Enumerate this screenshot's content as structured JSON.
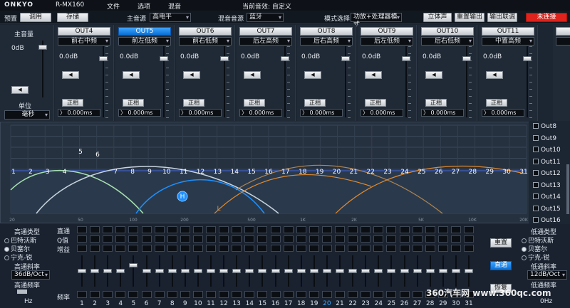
{
  "titlebar": {
    "logo": "ONKYO",
    "model": "R-MX160",
    "menus": [
      "文件",
      "选项",
      "混音"
    ],
    "preset_label": "当前音效: 自定义"
  },
  "toolbar": {
    "preset_btn": "预置",
    "call_btn": "调用",
    "save_btn": "存储",
    "main_source_label": "主音源",
    "main_source_value": "高电平",
    "mix_source_label": "混音音源",
    "mix_source_value": "蓝牙",
    "mode_label": "模式选择",
    "mode_value": "功放+处理器模式",
    "stereo_btn": "立体声",
    "reset_output_btn": "重置输出",
    "output_link_btn": "输出联调",
    "status": "未连接"
  },
  "master": {
    "title": "主音量",
    "db": "0dB",
    "unit_label": "单位",
    "unit_value": "毫秒",
    "mute_icon": "◀"
  },
  "strips": [
    {
      "out": "OUT4",
      "pos": "前右中频",
      "db": "0.0dB",
      "phase": "正相",
      "delay": "0.000ms",
      "active": false,
      "fader": 0.85
    },
    {
      "out": "OUT5",
      "pos": "前左低频",
      "db": "0.0dB",
      "phase": "正相",
      "delay": "0.000ms",
      "active": true,
      "fader": 0.85
    },
    {
      "out": "OUT6",
      "pos": "前右低频",
      "db": "0.0dB",
      "phase": "正相",
      "delay": "0.000ms",
      "active": false,
      "fader": 0.85
    },
    {
      "out": "OUT7",
      "pos": "后左高频",
      "db": "0.0dB",
      "phase": "正相",
      "delay": "0.000ms",
      "active": false,
      "fader": 0.85
    },
    {
      "out": "OUT8",
      "pos": "后右高频",
      "db": "0.0dB",
      "phase": "正相",
      "delay": "0.000ms",
      "active": false,
      "fader": 0.85
    },
    {
      "out": "OUT9",
      "pos": "后左低频",
      "db": "0.0dB",
      "phase": "正相",
      "delay": "0.000ms",
      "active": false,
      "fader": 0.85
    },
    {
      "out": "OUT10",
      "pos": "后右低频",
      "db": "0.0dB",
      "phase": "正相",
      "delay": "0.000ms",
      "active": false,
      "fader": 0.85
    },
    {
      "out": "OUT11",
      "pos": "中置高频",
      "db": "0.0dB",
      "phase": "正相",
      "delay": "0.000ms",
      "active": false,
      "fader": 0.85
    }
  ],
  "graph": {
    "band_numbers": [
      "1",
      "2",
      "3",
      "4",
      "5",
      "6",
      "7",
      "8",
      "9",
      "10",
      "11",
      "12",
      "13",
      "14",
      "15",
      "16",
      "17",
      "18",
      "19",
      "20",
      "21",
      "22",
      "23",
      "24",
      "25",
      "26",
      "27",
      "28",
      "29",
      "30",
      "31"
    ],
    "freq_ticks": [
      "20",
      "50",
      "100",
      "200",
      "500",
      "1K",
      "2K",
      "5K",
      "10K",
      "20K"
    ],
    "h_marker": "H",
    "l_marker": "L"
  },
  "out_list": [
    "Out8",
    "Out9",
    "Out10",
    "Out11",
    "Out12",
    "Out13",
    "Out14",
    "Out15",
    "Out16"
  ],
  "bottom": {
    "hp_type_label": "高通类型",
    "hp_types": [
      "巴特沃斯",
      "贝塞尔",
      "宁克-锐"
    ],
    "hp_slope_label": "高通斜率",
    "hp_slope_value": "36dB/Oct",
    "hp_freq_label": "高通频率",
    "hp_freq_value": "Hz",
    "row_labels": [
      "直通",
      "Q值",
      "增益",
      "频率"
    ],
    "reset_btn": "重置",
    "bypass_btn": "直通",
    "restore_btn": "恢复",
    "lp_type_label": "低通类型",
    "lp_types": [
      "巴特沃斯",
      "贝塞尔",
      "宁克-锐"
    ],
    "lp_slope_label": "低通斜率",
    "lp_slope_value": "12dB/Oct",
    "lp_freq_label": "低通频率",
    "lp_freq_value": "0Hz",
    "band_numbers": [
      "1",
      "2",
      "3",
      "4",
      "5",
      "6",
      "7",
      "8",
      "9",
      "10",
      "11",
      "12",
      "13",
      "14",
      "15",
      "16",
      "17",
      "18",
      "19",
      "20",
      "21",
      "22",
      "23",
      "24",
      "25",
      "26",
      "27",
      "28",
      "29",
      "30",
      "31"
    ]
  },
  "watermark": "360汽车网 www.360qc.com",
  "colors": {
    "accent": "#0a6fd6",
    "status_red": "#e0231c",
    "curve_h": "#1e90ff",
    "curve_l": "#e08a30",
    "curve_gray": "#c8d4de",
    "curve_green": "#a8e0b0"
  }
}
